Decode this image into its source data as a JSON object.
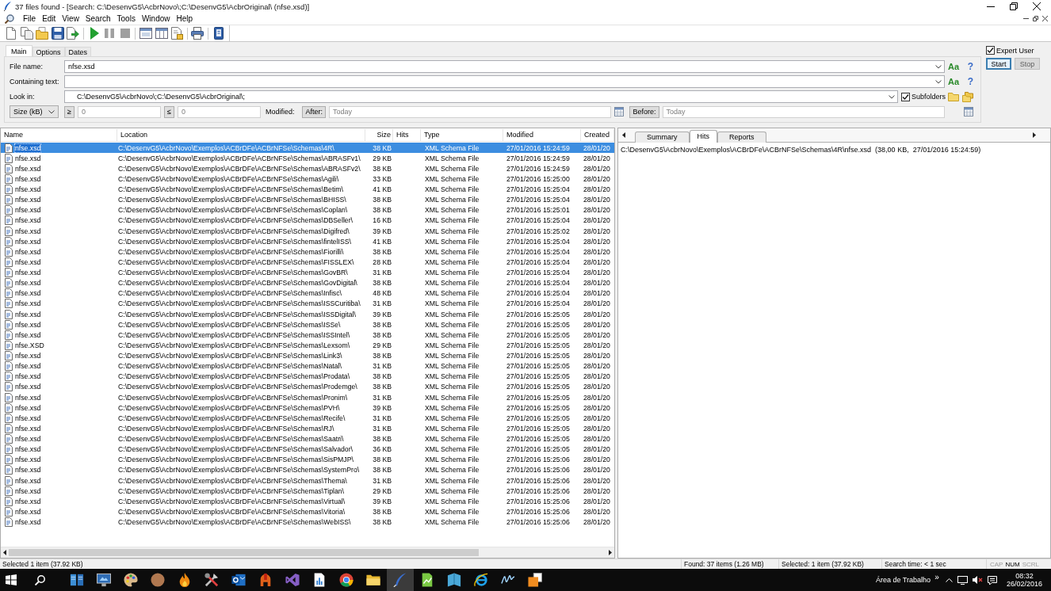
{
  "window": {
    "title": "37 files found - [Search: C:\\DesenvG5\\AcbrNovo\\;C:\\DesenvG5\\AcbrOriginal\\ (nfse.xsd)]"
  },
  "menu": [
    "File",
    "Edit",
    "View",
    "Search",
    "Tools",
    "Window",
    "Help"
  ],
  "search_panel": {
    "tabs": [
      {
        "label": "Main",
        "selected": true
      },
      {
        "label": "Options",
        "selected": false
      },
      {
        "label": "Dates",
        "selected": false
      }
    ],
    "file_name": {
      "label": "File name:",
      "value": "nfse.xsd",
      "case_toggle": "Aa",
      "help": "?"
    },
    "containing_text": {
      "label": "Containing text:",
      "case_toggle": "Aa",
      "help": "?"
    },
    "look_in": {
      "label": "Look in:",
      "value": "C:\\DesenvG5\\AcbrNovo\\;C:\\DesenvG5\\AcbrOriginal\\;"
    },
    "subfolders": {
      "label": "Subfolders",
      "checked": true
    },
    "size_unit": {
      "value": "Size (kB)"
    },
    "min_size": {
      "button": "≥",
      "value": "0",
      "disabled": true
    },
    "max_size": {
      "button": "≤",
      "value": "0",
      "disabled": true
    },
    "modified_label": "Modified:",
    "after": {
      "button": "After:",
      "value": "Today",
      "disabled": true
    },
    "before": {
      "button": "Before:",
      "value": "Today",
      "disabled": true
    },
    "expert_user": {
      "label": "Expert User",
      "checked": true
    },
    "buttons": [
      {
        "label": "Start",
        "disabled": false,
        "default": true
      },
      {
        "label": "Stop",
        "disabled": true,
        "default": false
      }
    ]
  },
  "results": {
    "columns": [
      "Name",
      "Location",
      "Size",
      "Hits",
      "Type",
      "Modified",
      "Created"
    ],
    "rows": [
      {
        "name": "nfse.xsd",
        "location": "C:\\DesenvG5\\AcbrNovo\\Exemplos\\ACBrDFe\\ACBrNFSe\\Schemas\\4R\\",
        "size": "38 KB",
        "type": "XML Schema File",
        "modified": "27/01/2016 15:24:59",
        "created": "28/01/20",
        "selected": true
      },
      {
        "name": "nfse.xsd",
        "location": "C:\\DesenvG5\\AcbrNovo\\Exemplos\\ACBrDFe\\ACBrNFSe\\Schemas\\ABRASFv1\\",
        "size": "29 KB",
        "type": "XML Schema File",
        "modified": "27/01/2016 15:24:59",
        "created": "28/01/20",
        "selected": false
      },
      {
        "name": "nfse.xsd",
        "location": "C:\\DesenvG5\\AcbrNovo\\Exemplos\\ACBrDFe\\ACBrNFSe\\Schemas\\ABRASFv2\\",
        "size": "38 KB",
        "type": "XML Schema File",
        "modified": "27/01/2016 15:24:59",
        "created": "28/01/20",
        "selected": false
      },
      {
        "name": "nfse.xsd",
        "location": "C:\\DesenvG5\\AcbrNovo\\Exemplos\\ACBrDFe\\ACBrNFSe\\Schemas\\Agili\\",
        "size": "33 KB",
        "type": "XML Schema File",
        "modified": "27/01/2016 15:25:00",
        "created": "28/01/20",
        "selected": false
      },
      {
        "name": "nfse.xsd",
        "location": "C:\\DesenvG5\\AcbrNovo\\Exemplos\\ACBrDFe\\ACBrNFSe\\Schemas\\Betim\\",
        "size": "41 KB",
        "type": "XML Schema File",
        "modified": "27/01/2016 15:25:04",
        "created": "28/01/20",
        "selected": false
      },
      {
        "name": "nfse.xsd",
        "location": "C:\\DesenvG5\\AcbrNovo\\Exemplos\\ACBrDFe\\ACBrNFSe\\Schemas\\BHISS\\",
        "size": "38 KB",
        "type": "XML Schema File",
        "modified": "27/01/2016 15:25:04",
        "created": "28/01/20",
        "selected": false
      },
      {
        "name": "nfse.xsd",
        "location": "C:\\DesenvG5\\AcbrNovo\\Exemplos\\ACBrDFe\\ACBrNFSe\\Schemas\\Coplan\\",
        "size": "38 KB",
        "type": "XML Schema File",
        "modified": "27/01/2016 15:25:01",
        "created": "28/01/20",
        "selected": false
      },
      {
        "name": "nfse.xsd",
        "location": "C:\\DesenvG5\\AcbrNovo\\Exemplos\\ACBrDFe\\ACBrNFSe\\Schemas\\DBSeller\\",
        "size": "16 KB",
        "type": "XML Schema File",
        "modified": "27/01/2016 15:25:04",
        "created": "28/01/20",
        "selected": false
      },
      {
        "name": "nfse.xsd",
        "location": "C:\\DesenvG5\\AcbrNovo\\Exemplos\\ACBrDFe\\ACBrNFSe\\Schemas\\Digifred\\",
        "size": "39 KB",
        "type": "XML Schema File",
        "modified": "27/01/2016 15:25:02",
        "created": "28/01/20",
        "selected": false
      },
      {
        "name": "nfse.xsd",
        "location": "C:\\DesenvG5\\AcbrNovo\\Exemplos\\ACBrDFe\\ACBrNFSe\\Schemas\\fintelISS\\",
        "size": "41 KB",
        "type": "XML Schema File",
        "modified": "27/01/2016 15:25:04",
        "created": "28/01/20",
        "selected": false
      },
      {
        "name": "nfse.xsd",
        "location": "C:\\DesenvG5\\AcbrNovo\\Exemplos\\ACBrDFe\\ACBrNFSe\\Schemas\\Fiorilli\\",
        "size": "38 KB",
        "type": "XML Schema File",
        "modified": "27/01/2016 15:25:04",
        "created": "28/01/20",
        "selected": false
      },
      {
        "name": "nfse.xsd",
        "location": "C:\\DesenvG5\\AcbrNovo\\Exemplos\\ACBrDFe\\ACBrNFSe\\Schemas\\FISSLEX\\",
        "size": "28 KB",
        "type": "XML Schema File",
        "modified": "27/01/2016 15:25:04",
        "created": "28/01/20",
        "selected": false
      },
      {
        "name": "nfse.xsd",
        "location": "C:\\DesenvG5\\AcbrNovo\\Exemplos\\ACBrDFe\\ACBrNFSe\\Schemas\\GovBR\\",
        "size": "31 KB",
        "type": "XML Schema File",
        "modified": "27/01/2016 15:25:04",
        "created": "28/01/20",
        "selected": false
      },
      {
        "name": "nfse.xsd",
        "location": "C:\\DesenvG5\\AcbrNovo\\Exemplos\\ACBrDFe\\ACBrNFSe\\Schemas\\GovDigital\\",
        "size": "38 KB",
        "type": "XML Schema File",
        "modified": "27/01/2016 15:25:04",
        "created": "28/01/20",
        "selected": false
      },
      {
        "name": "nfse.xsd",
        "location": "C:\\DesenvG5\\AcbrNovo\\Exemplos\\ACBrDFe\\ACBrNFSe\\Schemas\\Infisc\\",
        "size": "48 KB",
        "type": "XML Schema File",
        "modified": "27/01/2016 15:25:04",
        "created": "28/01/20",
        "selected": false
      },
      {
        "name": "nfse.xsd",
        "location": "C:\\DesenvG5\\AcbrNovo\\Exemplos\\ACBrDFe\\ACBrNFSe\\Schemas\\ISSCuritiba\\",
        "size": "31 KB",
        "type": "XML Schema File",
        "modified": "27/01/2016 15:25:04",
        "created": "28/01/20",
        "selected": false
      },
      {
        "name": "nfse.xsd",
        "location": "C:\\DesenvG5\\AcbrNovo\\Exemplos\\ACBrDFe\\ACBrNFSe\\Schemas\\ISSDigital\\",
        "size": "39 KB",
        "type": "XML Schema File",
        "modified": "27/01/2016 15:25:05",
        "created": "28/01/20",
        "selected": false
      },
      {
        "name": "nfse.xsd",
        "location": "C:\\DesenvG5\\AcbrNovo\\Exemplos\\ACBrDFe\\ACBrNFSe\\Schemas\\ISSe\\",
        "size": "38 KB",
        "type": "XML Schema File",
        "modified": "27/01/2016 15:25:05",
        "created": "28/01/20",
        "selected": false
      },
      {
        "name": "nfse.xsd",
        "location": "C:\\DesenvG5\\AcbrNovo\\Exemplos\\ACBrDFe\\ACBrNFSe\\Schemas\\ISSIntel\\",
        "size": "38 KB",
        "type": "XML Schema File",
        "modified": "27/01/2016 15:25:05",
        "created": "28/01/20",
        "selected": false
      },
      {
        "name": "nfse.XSD",
        "location": "C:\\DesenvG5\\AcbrNovo\\Exemplos\\ACBrDFe\\ACBrNFSe\\Schemas\\Lexsom\\",
        "size": "29 KB",
        "type": "XML Schema File",
        "modified": "27/01/2016 15:25:05",
        "created": "28/01/20",
        "selected": false
      },
      {
        "name": "nfse.xsd",
        "location": "C:\\DesenvG5\\AcbrNovo\\Exemplos\\ACBrDFe\\ACBrNFSe\\Schemas\\Link3\\",
        "size": "38 KB",
        "type": "XML Schema File",
        "modified": "27/01/2016 15:25:05",
        "created": "28/01/20",
        "selected": false
      },
      {
        "name": "nfse.xsd",
        "location": "C:\\DesenvG5\\AcbrNovo\\Exemplos\\ACBrDFe\\ACBrNFSe\\Schemas\\Natal\\",
        "size": "31 KB",
        "type": "XML Schema File",
        "modified": "27/01/2016 15:25:05",
        "created": "28/01/20",
        "selected": false
      },
      {
        "name": "nfse.xsd",
        "location": "C:\\DesenvG5\\AcbrNovo\\Exemplos\\ACBrDFe\\ACBrNFSe\\Schemas\\Prodata\\",
        "size": "38 KB",
        "type": "XML Schema File",
        "modified": "27/01/2016 15:25:05",
        "created": "28/01/20",
        "selected": false
      },
      {
        "name": "nfse.xsd",
        "location": "C:\\DesenvG5\\AcbrNovo\\Exemplos\\ACBrDFe\\ACBrNFSe\\Schemas\\Prodemge\\",
        "size": "38 KB",
        "type": "XML Schema File",
        "modified": "27/01/2016 15:25:05",
        "created": "28/01/20",
        "selected": false
      },
      {
        "name": "nfse.xsd",
        "location": "C:\\DesenvG5\\AcbrNovo\\Exemplos\\ACBrDFe\\ACBrNFSe\\Schemas\\Pronim\\",
        "size": "31 KB",
        "type": "XML Schema File",
        "modified": "27/01/2016 15:25:05",
        "created": "28/01/20",
        "selected": false
      },
      {
        "name": "nfse.xsd",
        "location": "C:\\DesenvG5\\AcbrNovo\\Exemplos\\ACBrDFe\\ACBrNFSe\\Schemas\\PVH\\",
        "size": "39 KB",
        "type": "XML Schema File",
        "modified": "27/01/2016 15:25:05",
        "created": "28/01/20",
        "selected": false
      },
      {
        "name": "nfse.xsd",
        "location": "C:\\DesenvG5\\AcbrNovo\\Exemplos\\ACBrDFe\\ACBrNFSe\\Schemas\\Recife\\",
        "size": "31 KB",
        "type": "XML Schema File",
        "modified": "27/01/2016 15:25:05",
        "created": "28/01/20",
        "selected": false
      },
      {
        "name": "nfse.xsd",
        "location": "C:\\DesenvG5\\AcbrNovo\\Exemplos\\ACBrDFe\\ACBrNFSe\\Schemas\\RJ\\",
        "size": "31 KB",
        "type": "XML Schema File",
        "modified": "27/01/2016 15:25:05",
        "created": "28/01/20",
        "selected": false
      },
      {
        "name": "nfse.xsd",
        "location": "C:\\DesenvG5\\AcbrNovo\\Exemplos\\ACBrDFe\\ACBrNFSe\\Schemas\\Saatri\\",
        "size": "38 KB",
        "type": "XML Schema File",
        "modified": "27/01/2016 15:25:05",
        "created": "28/01/20",
        "selected": false
      },
      {
        "name": "nfse.xsd",
        "location": "C:\\DesenvG5\\AcbrNovo\\Exemplos\\ACBrDFe\\ACBrNFSe\\Schemas\\Salvador\\",
        "size": "36 KB",
        "type": "XML Schema File",
        "modified": "27/01/2016 15:25:05",
        "created": "28/01/20",
        "selected": false
      },
      {
        "name": "nfse.xsd",
        "location": "C:\\DesenvG5\\AcbrNovo\\Exemplos\\ACBrDFe\\ACBrNFSe\\Schemas\\SisPMJP\\",
        "size": "38 KB",
        "type": "XML Schema File",
        "modified": "27/01/2016 15:25:06",
        "created": "28/01/20",
        "selected": false
      },
      {
        "name": "nfse.xsd",
        "location": "C:\\DesenvG5\\AcbrNovo\\Exemplos\\ACBrDFe\\ACBrNFSe\\Schemas\\SystemPro\\",
        "size": "38 KB",
        "type": "XML Schema File",
        "modified": "27/01/2016 15:25:06",
        "created": "28/01/20",
        "selected": false
      },
      {
        "name": "nfse.xsd",
        "location": "C:\\DesenvG5\\AcbrNovo\\Exemplos\\ACBrDFe\\ACBrNFSe\\Schemas\\Thema\\",
        "size": "31 KB",
        "type": "XML Schema File",
        "modified": "27/01/2016 15:25:06",
        "created": "28/01/20",
        "selected": false
      },
      {
        "name": "nfse.xsd",
        "location": "C:\\DesenvG5\\AcbrNovo\\Exemplos\\ACBrDFe\\ACBrNFSe\\Schemas\\Tiplan\\",
        "size": "29 KB",
        "type": "XML Schema File",
        "modified": "27/01/2016 15:25:06",
        "created": "28/01/20",
        "selected": false
      },
      {
        "name": "nfse.xsd",
        "location": "C:\\DesenvG5\\AcbrNovo\\Exemplos\\ACBrDFe\\ACBrNFSe\\Schemas\\Virtual\\",
        "size": "39 KB",
        "type": "XML Schema File",
        "modified": "27/01/2016 15:25:06",
        "created": "28/01/20",
        "selected": false
      },
      {
        "name": "nfse.xsd",
        "location": "C:\\DesenvG5\\AcbrNovo\\Exemplos\\ACBrDFe\\ACBrNFSe\\Schemas\\Vitoria\\",
        "size": "38 KB",
        "type": "XML Schema File",
        "modified": "27/01/2016 15:25:06",
        "created": "28/01/20",
        "selected": false
      },
      {
        "name": "nfse.xsd",
        "location": "C:\\DesenvG5\\AcbrNovo\\Exemplos\\ACBrDFe\\ACBrNFSe\\Schemas\\WebISS\\",
        "size": "38 KB",
        "type": "XML Schema File",
        "modified": "27/01/2016 15:25:06",
        "created": "28/01/20",
        "selected": false
      }
    ]
  },
  "detail": {
    "tabs": [
      {
        "label": "Summary",
        "selected": false
      },
      {
        "label": "Hits",
        "selected": true
      },
      {
        "label": "Reports",
        "selected": false
      }
    ],
    "hits": [
      "C:\\DesenvG5\\AcbrNovo\\Exemplos\\ACBrDFe\\ACBrNFSe\\Schemas\\4R\\nfse.xsd  (38,00 KB,  27/01/2016 15:24:59)"
    ]
  },
  "status_bar": {
    "left": "Selected 1 item (37.92 KB)",
    "found": "Found: 37 items (1.26 MB)",
    "selected": "Selected: 1 item (37.92 KB)",
    "search_time": "Search time: < 1 sec",
    "indicators": [
      {
        "label": "CAP",
        "on": false
      },
      {
        "label": "NUM",
        "on": true
      },
      {
        "label": "SCRL",
        "on": false
      }
    ]
  },
  "taskbar": {
    "apps": [
      {
        "active": false
      },
      {
        "active": false
      },
      {
        "active": false
      },
      {
        "active": false
      },
      {
        "active": false
      },
      {
        "active": false
      },
      {
        "active": false
      },
      {
        "active": false
      },
      {
        "active": false
      },
      {
        "active": false
      },
      {
        "active": false
      },
      {
        "active": false
      },
      {
        "active": true
      },
      {
        "active": false
      },
      {
        "active": false
      },
      {
        "active": false
      },
      {
        "active": false
      },
      {
        "active": false
      }
    ],
    "toolbar_label": "Área de Trabalho",
    "overflow": "»",
    "time": "08:32",
    "date": "26/02/2016"
  }
}
